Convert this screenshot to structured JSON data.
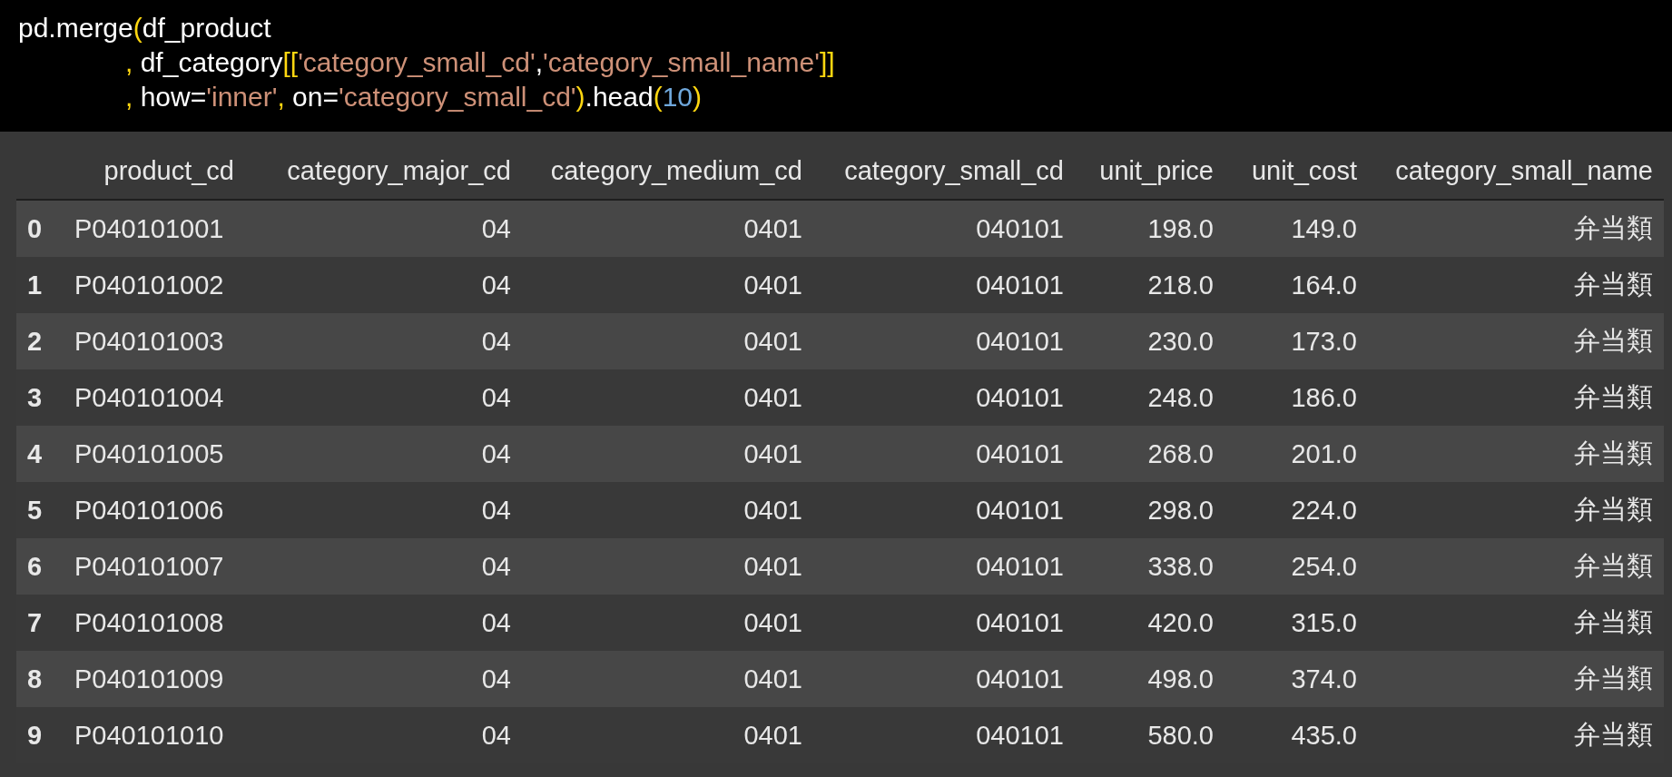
{
  "code": {
    "lines": [
      {
        "continuation": false,
        "tokens": [
          {
            "kind": "plain",
            "text": "pd.merge"
          },
          {
            "kind": "bracket",
            "text": "("
          },
          {
            "kind": "plain",
            "text": "df_product"
          }
        ]
      },
      {
        "continuation": true,
        "tokens": [
          {
            "kind": "comma",
            "text": ","
          },
          {
            "kind": "plain",
            "text": " df_category"
          },
          {
            "kind": "bracket",
            "text": "[["
          },
          {
            "kind": "string",
            "text": "'category_small_cd'"
          },
          {
            "kind": "plain",
            "text": ","
          },
          {
            "kind": "string",
            "text": "'category_small_name'"
          },
          {
            "kind": "bracket",
            "text": "]]"
          }
        ]
      },
      {
        "continuation": true,
        "tokens": [
          {
            "kind": "comma",
            "text": ","
          },
          {
            "kind": "plain",
            "text": " how="
          },
          {
            "kind": "string",
            "text": "'inner'"
          },
          {
            "kind": "comma",
            "text": ","
          },
          {
            "kind": "plain",
            "text": " on="
          },
          {
            "kind": "string",
            "text": "'category_small_cd'"
          },
          {
            "kind": "bracket",
            "text": ")"
          },
          {
            "kind": "plain",
            "text": ".head"
          },
          {
            "kind": "bracket",
            "text": "("
          },
          {
            "kind": "number",
            "text": "10"
          },
          {
            "kind": "bracket",
            "text": ")"
          }
        ]
      }
    ]
  },
  "table": {
    "columns": [
      "product_cd",
      "category_major_cd",
      "category_medium_cd",
      "category_small_cd",
      "unit_price",
      "unit_cost",
      "category_small_name"
    ],
    "rows": [
      {
        "index": "0",
        "cells": [
          "P040101001",
          "04",
          "0401",
          "040101",
          "198.0",
          "149.0",
          "弁当類"
        ]
      },
      {
        "index": "1",
        "cells": [
          "P040101002",
          "04",
          "0401",
          "040101",
          "218.0",
          "164.0",
          "弁当類"
        ]
      },
      {
        "index": "2",
        "cells": [
          "P040101003",
          "04",
          "0401",
          "040101",
          "230.0",
          "173.0",
          "弁当類"
        ]
      },
      {
        "index": "3",
        "cells": [
          "P040101004",
          "04",
          "0401",
          "040101",
          "248.0",
          "186.0",
          "弁当類"
        ]
      },
      {
        "index": "4",
        "cells": [
          "P040101005",
          "04",
          "0401",
          "040101",
          "268.0",
          "201.0",
          "弁当類"
        ]
      },
      {
        "index": "5",
        "cells": [
          "P040101006",
          "04",
          "0401",
          "040101",
          "298.0",
          "224.0",
          "弁当類"
        ]
      },
      {
        "index": "6",
        "cells": [
          "P040101007",
          "04",
          "0401",
          "040101",
          "338.0",
          "254.0",
          "弁当類"
        ]
      },
      {
        "index": "7",
        "cells": [
          "P040101008",
          "04",
          "0401",
          "040101",
          "420.0",
          "315.0",
          "弁当類"
        ]
      },
      {
        "index": "8",
        "cells": [
          "P040101009",
          "04",
          "0401",
          "040101",
          "498.0",
          "374.0",
          "弁当類"
        ]
      },
      {
        "index": "9",
        "cells": [
          "P040101010",
          "04",
          "0401",
          "040101",
          "580.0",
          "435.0",
          "弁当類"
        ]
      }
    ]
  }
}
